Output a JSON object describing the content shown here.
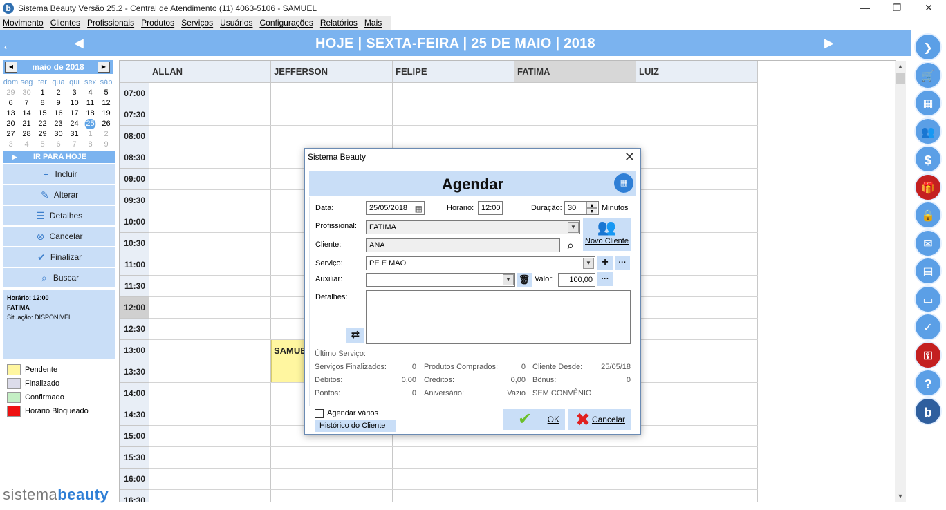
{
  "window": {
    "title": "Sistema Beauty Versão 25.2 - Central de Atendimento (11) 4063-5106 - SAMUEL",
    "logo_letter": "b",
    "minimize": "—",
    "restore": "❐",
    "close": "✕"
  },
  "menu": [
    "Movimento",
    "Clientes",
    "Profissionais",
    "Produtos",
    "Serviços",
    "Usuários",
    "Configurações",
    "Relatórios",
    "Mais"
  ],
  "nav": {
    "date_title": "HOJE | SEXTA-FEIRA | 25 DE MAIO | 2018",
    "prev": "◀",
    "next": "▶",
    "collapse": "‹"
  },
  "calendar": {
    "month": "maio de 2018",
    "prev": "◀",
    "next": "▶",
    "weekdays": [
      "dom",
      "seg",
      "ter",
      "qua",
      "qui",
      "sex",
      "sáb"
    ],
    "weeks": [
      [
        "29",
        "30",
        "1",
        "2",
        "3",
        "4",
        "5"
      ],
      [
        "6",
        "7",
        "8",
        "9",
        "10",
        "11",
        "12"
      ],
      [
        "13",
        "14",
        "15",
        "16",
        "17",
        "18",
        "19"
      ],
      [
        "20",
        "21",
        "22",
        "23",
        "24",
        "25",
        "26"
      ],
      [
        "27",
        "28",
        "29",
        "30",
        "31",
        "1",
        "2"
      ],
      [
        "3",
        "4",
        "5",
        "6",
        "7",
        "8",
        "9"
      ]
    ],
    "today": "25",
    "go_today": "IR PARA HOJE"
  },
  "actions": [
    {
      "label": "Incluir",
      "icon": "plus-icon",
      "glyph": "+"
    },
    {
      "label": "Alterar",
      "icon": "edit-icon",
      "glyph": "✎"
    },
    {
      "label": "Detalhes",
      "icon": "list-icon",
      "glyph": "☰"
    },
    {
      "label": "Cancelar",
      "icon": "cancel-circle-icon",
      "glyph": "⊗"
    },
    {
      "label": "Finalizar",
      "icon": "check-circle-icon",
      "glyph": "✔"
    },
    {
      "label": "Buscar",
      "icon": "search-icon",
      "glyph": "⌕"
    }
  ],
  "info": {
    "horario": "Horário: 12:00",
    "profissional": "FATIMA",
    "situacao": "Situação: DISPONÍVEL"
  },
  "legend": [
    {
      "label": "Pendente",
      "color": "#fff6a0"
    },
    {
      "label": "Finalizado",
      "color": "#dcdcea"
    },
    {
      "label": "Confirmado",
      "color": "#c4efc4"
    },
    {
      "label": "Horário Bloqueado",
      "color": "#ee1111"
    }
  ],
  "brand": {
    "part1": "sistema",
    "part2": "beauty"
  },
  "schedule": {
    "professionals": [
      "ALLAN",
      "JEFFERSON",
      "FELIPE",
      "FATIMA",
      "LUIZ"
    ],
    "selected_professional": "FATIMA",
    "times": [
      "07:00",
      "07:30",
      "08:00",
      "08:30",
      "09:00",
      "09:30",
      "10:00",
      "10:30",
      "11:00",
      "11:30",
      "12:00",
      "12:30",
      "13:00",
      "13:30",
      "14:00",
      "14:30",
      "15:00",
      "15:30",
      "16:00",
      "16:30"
    ],
    "current_time": "12:00",
    "appointment": {
      "client": "SAMUEL",
      "professional": "JEFFERSON",
      "start": "13:00",
      "end": "14:00"
    }
  },
  "sidebar_icons": [
    {
      "name": "arrow-right-circle-icon",
      "glyph": "❯",
      "style": "blue"
    },
    {
      "name": "cart-icon",
      "glyph": "🛒",
      "style": "blue"
    },
    {
      "name": "cash-register-icon",
      "glyph": "▦",
      "style": "blue"
    },
    {
      "name": "users-icon",
      "glyph": "👥",
      "style": "blue"
    },
    {
      "name": "money-icon",
      "glyph": "$",
      "style": "blue"
    },
    {
      "name": "gift-icon",
      "glyph": "🎁",
      "style": "red"
    },
    {
      "name": "lock-icon",
      "glyph": "🔒",
      "style": "blue"
    },
    {
      "name": "mail-icon",
      "glyph": "✉",
      "style": "blue"
    },
    {
      "name": "calculator-icon",
      "glyph": "▤",
      "style": "blue"
    },
    {
      "name": "document-icon",
      "glyph": "▭",
      "style": "blue"
    },
    {
      "name": "checklist-icon",
      "glyph": "✓",
      "style": "blue"
    },
    {
      "name": "key-icon",
      "glyph": "⚿",
      "style": "red"
    },
    {
      "name": "help-icon",
      "glyph": "?",
      "style": "blue"
    },
    {
      "name": "beauty-logo-icon",
      "glyph": "b",
      "style": "dark"
    }
  ],
  "dialog": {
    "window_title": "Sistema Beauty",
    "close": "✕",
    "heading": "Agendar",
    "heading_icon": "▦",
    "labels": {
      "data": "Data:",
      "horario": "Horário:",
      "duracao": "Duração:",
      "minutos": "Minutos",
      "profissional": "Profissional:",
      "cliente": "Cliente:",
      "servico": "Serviço:",
      "auxiliar": "Auxiliar:",
      "valor": "Valor:",
      "detalhes": "Detalhes:",
      "novo_cliente": "Novo Cliente"
    },
    "values": {
      "data": "25/05/2018",
      "horario": "12:00",
      "duracao": "30",
      "profissional": "FATIMA",
      "cliente": "ANA",
      "servico": "PE E MAO",
      "auxiliar": "",
      "valor": "100,00",
      "detalhes": ""
    },
    "ultimo_servico": "Último Serviço:",
    "stats": [
      {
        "label": "Serviços Finalizados:",
        "value": "0"
      },
      {
        "label": "Produtos Comprados:",
        "value": "0"
      },
      {
        "label": "Cliente Desde:",
        "value": "25/05/18"
      },
      {
        "label": "Débitos:",
        "value": "0,00"
      },
      {
        "label": "Créditos:",
        "value": "0,00"
      },
      {
        "label": "Bônus:",
        "value": "0"
      },
      {
        "label": "Pontos:",
        "value": "0"
      },
      {
        "label": "Aniversário:",
        "value": "Vazio"
      },
      {
        "label": "SEM CONVÊNIO",
        "value": ""
      }
    ],
    "agendar_varios": "Agendar vários",
    "historico": "Histórico do Cliente",
    "ok": "OK",
    "cancelar": "Cancelar"
  }
}
